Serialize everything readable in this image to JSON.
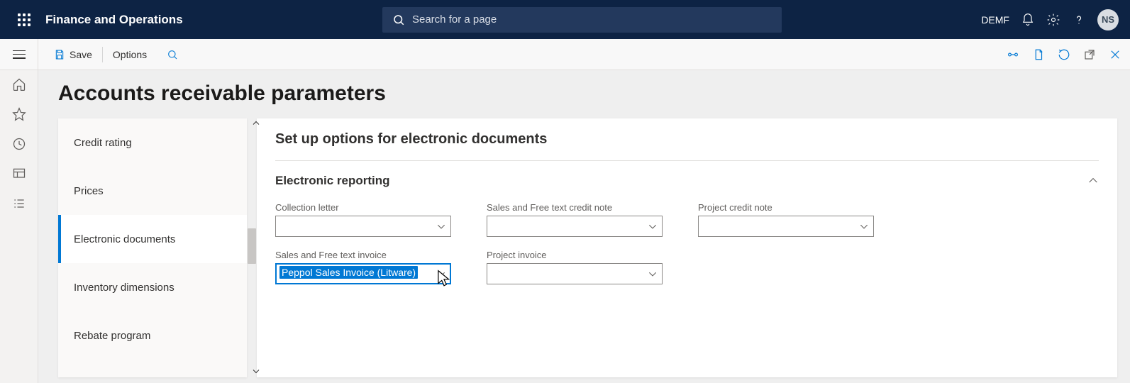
{
  "header": {
    "app_title": "Finance and Operations",
    "search_placeholder": "Search for a page",
    "legal_entity": "DEMF",
    "avatar_initials": "NS"
  },
  "action_bar": {
    "save_label": "Save",
    "options_label": "Options"
  },
  "page": {
    "title": "Accounts receivable parameters"
  },
  "sidebar": {
    "items": [
      {
        "label": "Credit rating"
      },
      {
        "label": "Prices"
      },
      {
        "label": "Electronic documents"
      },
      {
        "label": "Inventory dimensions"
      },
      {
        "label": "Rebate program"
      }
    ],
    "active_index": 2
  },
  "panel": {
    "title": "Set up options for electronic documents",
    "section_title": "Electronic reporting",
    "fields": {
      "collection_letter": {
        "label": "Collection letter",
        "value": ""
      },
      "sales_credit_note": {
        "label": "Sales and Free text credit note",
        "value": ""
      },
      "project_credit_note": {
        "label": "Project credit note",
        "value": ""
      },
      "sales_invoice": {
        "label": "Sales and Free text invoice",
        "value": "Peppol Sales Invoice (Litware)"
      },
      "project_invoice": {
        "label": "Project invoice",
        "value": ""
      }
    }
  }
}
